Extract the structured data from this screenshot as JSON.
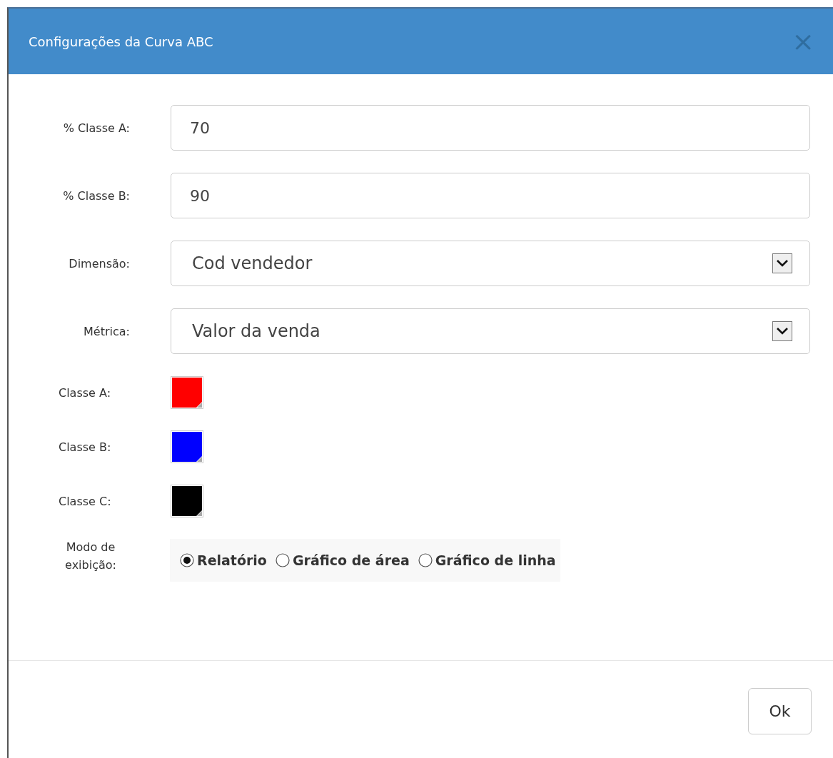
{
  "dialog": {
    "title": "Configurações da Curva ABC",
    "close": "×"
  },
  "fields": [
    {
      "kind": "text",
      "label": "% Classe A:",
      "value": "70"
    },
    {
      "kind": "text",
      "label": "% Classe B:",
      "value": "90"
    },
    {
      "kind": "select",
      "label": "Dimensão:",
      "value": "Cod vendedor"
    },
    {
      "kind": "select",
      "label": "Métrica:",
      "value": "Valor da venda"
    }
  ],
  "colors": [
    {
      "label": "Classe A:",
      "color": "#ff0000"
    },
    {
      "label": "Classe B:",
      "color": "#0000ff"
    },
    {
      "label": "Classe C:",
      "color": "#000000"
    }
  ],
  "display_mode": {
    "label": "Modo de exibição:",
    "options": [
      {
        "label": "Relatório",
        "selected": true
      },
      {
        "label": "Gráfico de área",
        "selected": false
      },
      {
        "label": "Gráfico de linha",
        "selected": false
      }
    ]
  },
  "buttons": [
    "Ok"
  ]
}
